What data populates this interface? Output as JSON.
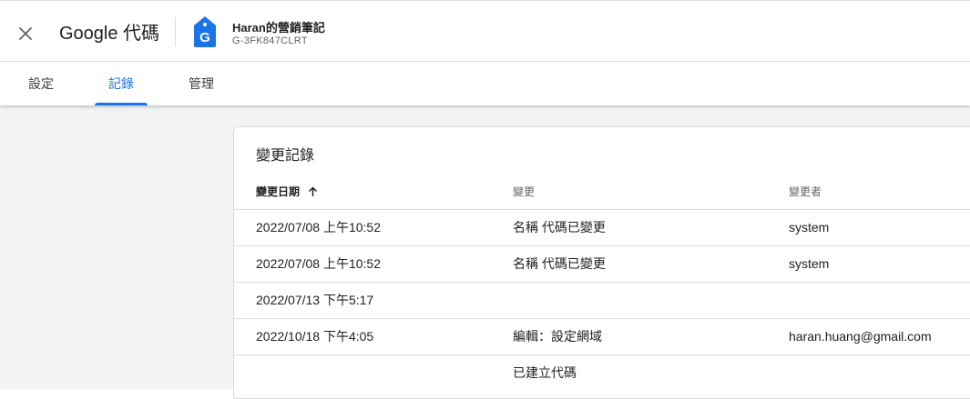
{
  "header": {
    "app_title": "Google 代碼",
    "container_name": "Haran的營銷筆記",
    "container_id": "G-3FK847CLRT",
    "tag_icon_letter": "G"
  },
  "tabs": [
    {
      "label": "設定",
      "active": false
    },
    {
      "label": "記錄",
      "active": true
    },
    {
      "label": "管理",
      "active": false
    }
  ],
  "history": {
    "title": "變更記錄",
    "columns": {
      "date": "變更日期",
      "change": "變更",
      "user": "變更者"
    },
    "rows": [
      {
        "date": "2022/07/08 上午10:52",
        "change": "名稱 代碼已變更",
        "user": "system"
      },
      {
        "date": "2022/07/08 上午10:52",
        "change": "名稱 代碼已變更",
        "user": "system"
      },
      {
        "date": "2022/07/13 下午5:17",
        "change": "",
        "user": ""
      },
      {
        "date": "2022/10/18 下午4:05",
        "change": "編輯：設定網域",
        "user": "haran.huang@gmail.com"
      },
      {
        "date": "",
        "change": "已建立代碼",
        "user": ""
      }
    ]
  },
  "colors": {
    "accent": "#1a73e8",
    "background": "#f1f3f4",
    "divider": "#dadce0"
  }
}
